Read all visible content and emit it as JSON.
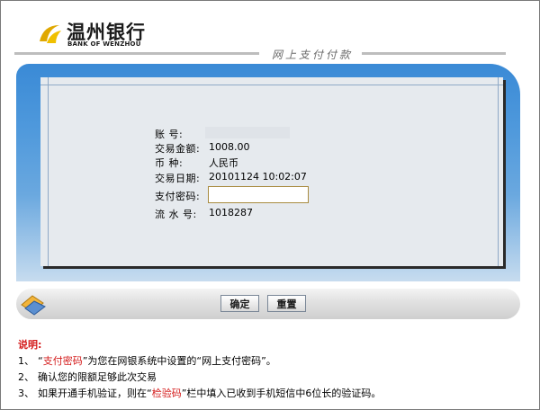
{
  "header": {
    "bank_name_cn": "温州银行",
    "bank_name_en": "BANK OF WENZHOU",
    "section_title": "网上支付付款"
  },
  "form": {
    "account": {
      "label": "账  号:",
      "value": ""
    },
    "amount": {
      "label": "交易金额:",
      "value": "1008.00"
    },
    "currency": {
      "label": "币  种:",
      "value": "人民币"
    },
    "date": {
      "label": "交易日期:",
      "value": "20101124 10:02:07"
    },
    "password": {
      "label": "支付密码:",
      "value": ""
    },
    "serial": {
      "label": "流 水 号:",
      "value": "1018287"
    }
  },
  "buttons": {
    "confirm": "确定",
    "reset": "重置"
  },
  "notes": {
    "title": "说明:",
    "items": [
      {
        "num": "1、",
        "pre": "“",
        "highlight": "支付密码",
        "post": "”为您在网银系统中设置的“网上支付密码”。"
      },
      {
        "num": "2、",
        "text": "确认您的限额足够此次交易"
      },
      {
        "num": "3、",
        "pre": "如果开通手机验证，则在“",
        "highlight": "检验码",
        "post": "”栏中填入已收到手机短信中6位长的验证码。"
      }
    ]
  },
  "colors": {
    "panel_blue": "#3a8ad6",
    "highlight_red": "#d41c1c",
    "logo_gold": "#e0a800"
  },
  "icons": [
    "bank-logo-icon",
    "card-decoration-icon"
  ]
}
